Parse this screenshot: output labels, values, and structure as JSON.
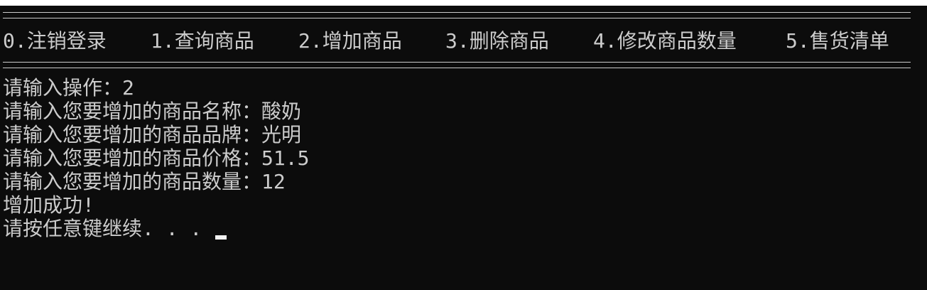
{
  "console": {
    "menu": [
      "0.注销登录",
      "1.查询商品",
      "2.增加商品",
      "3.删除商品",
      "4.修改商品数量",
      "5.售货清单"
    ],
    "lines": [
      "请输入操作：2",
      "请输入您要增加的商品名称：酸奶",
      "请输入您要增加的商品品牌：光明",
      "请输入您要增加的商品价格：51.5",
      "请输入您要增加的商品数量：12",
      "增加成功!",
      "请按任意键继续. . . "
    ],
    "colors": {
      "background": "#0c0c0c",
      "foreground": "#cccccc",
      "cursor": "#f2f2f2"
    }
  }
}
